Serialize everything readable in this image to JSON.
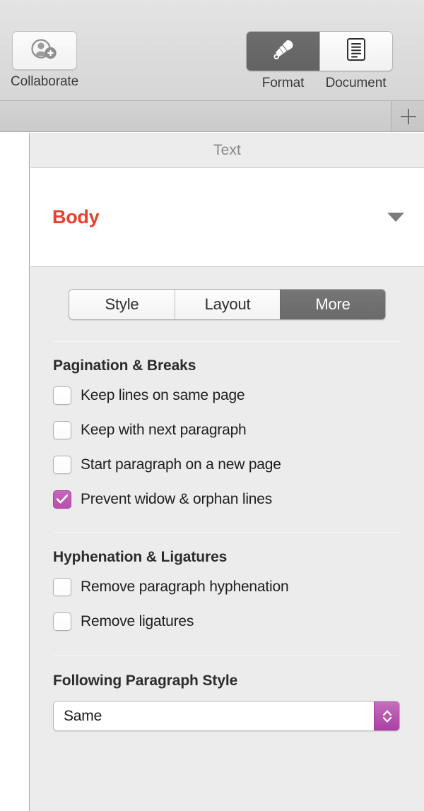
{
  "toolbar": {
    "collaborate": {
      "label": "Collaborate",
      "icon": "person-add-icon"
    },
    "segments": [
      {
        "label": "Format",
        "icon": "paintbrush-icon",
        "selected": true
      },
      {
        "label": "Document",
        "icon": "document-lines-icon",
        "selected": false
      }
    ]
  },
  "tabbar": {
    "add_label": "+",
    "add_icon": "plus-icon"
  },
  "inspector": {
    "title": "Text",
    "paragraph_style": {
      "name": "Body",
      "color": "#e8402a",
      "disclosure_icon": "chevron-down-icon"
    },
    "tabs": [
      {
        "label": "Style",
        "selected": false
      },
      {
        "label": "Layout",
        "selected": false
      },
      {
        "label": "More",
        "selected": true
      }
    ],
    "sections": [
      {
        "title": "Pagination & Breaks",
        "checkboxes": [
          {
            "label": "Keep lines on same page",
            "checked": false
          },
          {
            "label": "Keep with next paragraph",
            "checked": false
          },
          {
            "label": "Start paragraph on a new page",
            "checked": false
          },
          {
            "label": "Prevent widow & orphan lines",
            "checked": true
          }
        ]
      },
      {
        "title": "Hyphenation & Ligatures",
        "checkboxes": [
          {
            "label": "Remove paragraph hyphenation",
            "checked": false
          },
          {
            "label": "Remove ligatures",
            "checked": false
          }
        ]
      }
    ],
    "following_paragraph_style": {
      "title": "Following Paragraph Style",
      "value": "Same",
      "stepper_icon": "chevron-up-down-icon"
    }
  },
  "colors": {
    "accent_purple": "#bf57b5",
    "style_red": "#e8402a",
    "selected_gray": "#6a6a6a",
    "panel_bg": "#ececec"
  }
}
